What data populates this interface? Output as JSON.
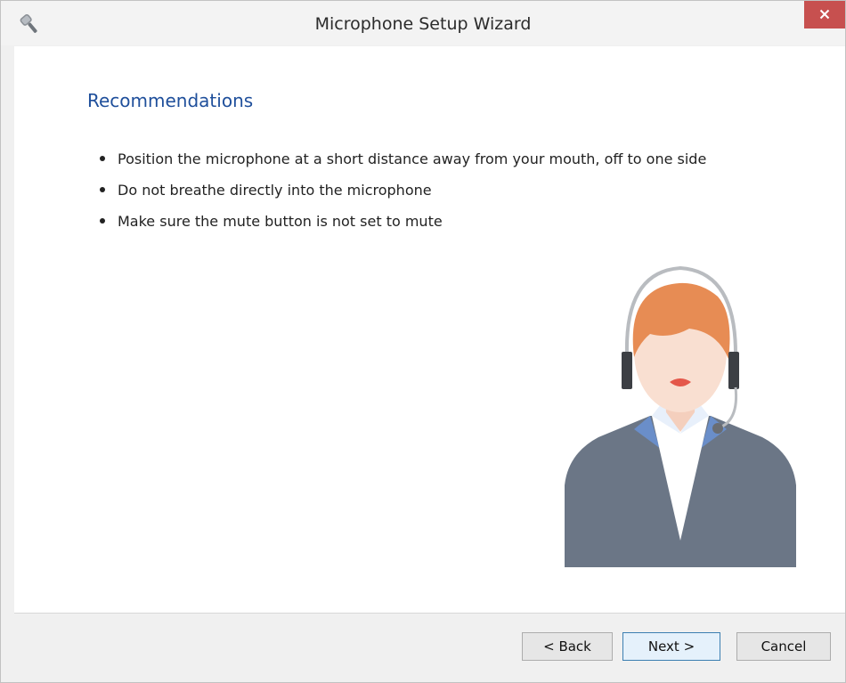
{
  "window": {
    "title": "Microphone Setup Wizard",
    "close_label": "×"
  },
  "content": {
    "heading": "Recommendations",
    "tips": [
      "Position the microphone at a short distance away from your mouth, off to one side",
      "Do not breathe directly into the microphone",
      "Make sure the mute button is not set to mute"
    ]
  },
  "footer": {
    "back_label": "< Back",
    "next_label": "Next >",
    "cancel_label": "Cancel"
  },
  "colors": {
    "heading": "#1f4f9b",
    "close": "#c7504f",
    "suit": "#6b7686",
    "hair": "#e78c54",
    "skin": "#f9dfd1"
  },
  "icons": [
    "microphone-icon",
    "close-icon"
  ]
}
